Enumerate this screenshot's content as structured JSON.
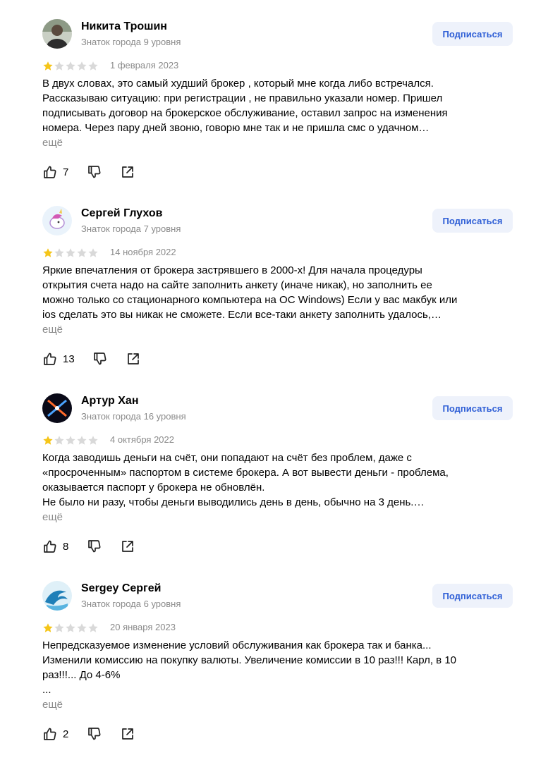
{
  "reviews": [
    {
      "author": "Никита Трошин",
      "level": "Знаток города 9 уровня",
      "subscribe_label": "Подписаться",
      "rating": 1,
      "date": "1 февраля 2023",
      "lines": [
        "В двух словах, это самый худший брокер , который мне когда либо встречался.",
        "Рассказываю ситуацию: при регистрации , не правильно указали номер. Пришел",
        "подписывать договор на брокерское обслуживание, оставил запрос на изменения",
        "номера. Через пару дней звоню, говорю мне так и не пришла смс о удачном…"
      ],
      "more_label": "ещё",
      "likes": "7",
      "avatar_icon": "person-photo-avatar"
    },
    {
      "author": "Сергей Глухов",
      "level": "Знаток города 7 уровня",
      "subscribe_label": "Подписаться",
      "rating": 1,
      "date": "14 ноября 2022",
      "lines": [
        "Яркие впечатления от брокера застрявшего в 2000-х! Для начала процедуры",
        "открытия счета надо на сайте заполнить анкету (иначе никак), но заполнить ее",
        "можно только со стационарного компьютера на ОС Windows) Если у вас макбук или",
        "ios сделать это вы никак не сможете. Если все-таки анкету заполнить удалось,…"
      ],
      "more_label": "ещё",
      "likes": "13",
      "avatar_icon": "unicorn-avatar"
    },
    {
      "author": "Артур Хан",
      "level": "Знаток города 16 уровня",
      "subscribe_label": "Подписаться",
      "rating": 1,
      "date": "4 октября 2022",
      "lines": [
        "Когда заводишь деньги на счёт, они попадают на счёт без проблем, даже с",
        "«просроченным» паспортом в системе брокера. А вот вывести деньги - проблема,",
        "оказывается паспорт у брокера не обновлён.",
        "Не было ни разу, чтобы деньги выводились день в день, обычно на 3 день.…"
      ],
      "more_label": "ещё",
      "likes": "8",
      "avatar_icon": "neon-x-avatar"
    },
    {
      "author": "Sergey Сергей",
      "level": "Знаток города 6 уровня",
      "subscribe_label": "Подписаться",
      "rating": 1,
      "date": "20 января 2023",
      "lines": [
        "Непредсказуемое изменение условий обслуживания как брокера так и банка...",
        "Изменили комиссию на покупку валюты. Увеличение комиссии в 10 раз!!! Карл, в 10",
        "раз!!!... До 4-6%",
        "..."
      ],
      "more_label": "ещё",
      "likes": "2",
      "avatar_icon": "wave-avatar"
    }
  ],
  "colors": {
    "star_filled": "#f5c518",
    "star_empty": "#d9d9d9",
    "subscribe_bg": "#eef2fb",
    "subscribe_text": "#2f5fd6",
    "muted_text": "#8a8a8a"
  }
}
